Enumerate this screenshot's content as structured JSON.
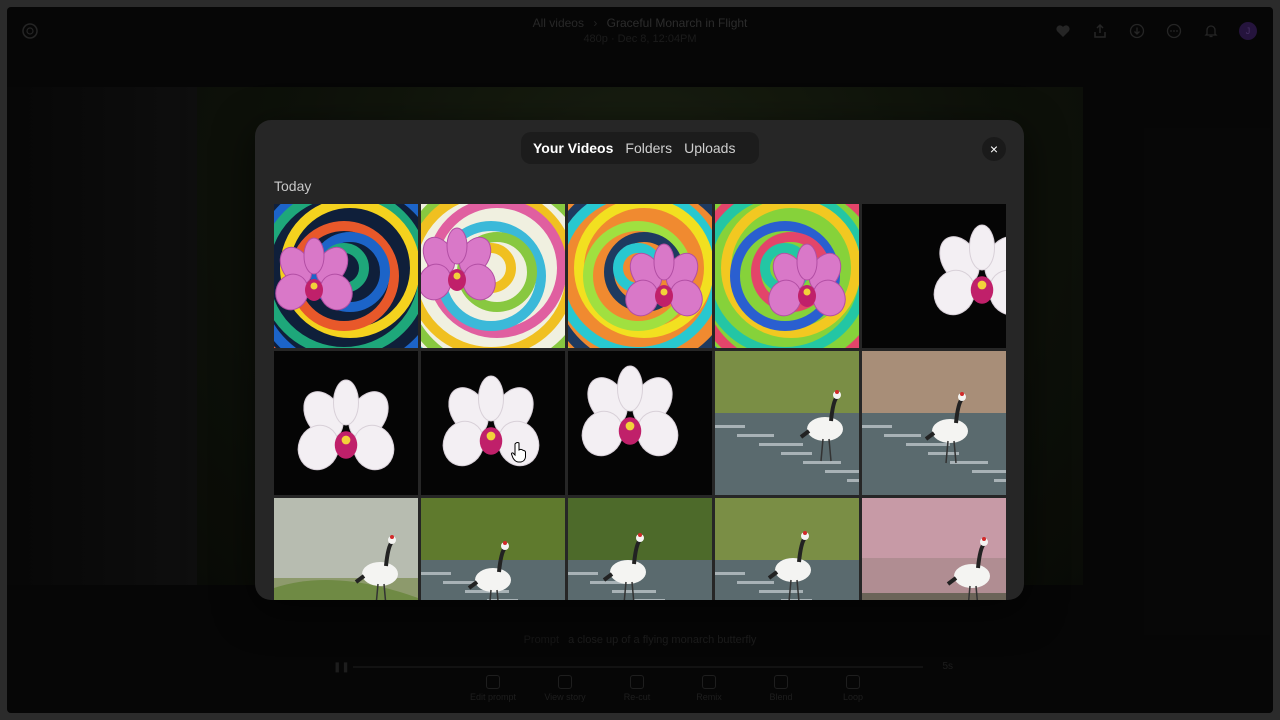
{
  "topbar": {
    "crumb_parent": "All videos",
    "crumb_title": "Graceful Monarch in Flight",
    "meta": "480p · Dec 8, 12:04PM",
    "avatar_initial": "J",
    "icons": [
      "heart-icon",
      "share-icon",
      "download-icon",
      "more-icon",
      "bell-icon"
    ]
  },
  "prompt": {
    "label": "Prompt",
    "text": "a close up of a flying monarch butterfly"
  },
  "player": {
    "duration": "5s"
  },
  "toolbar": {
    "items": [
      {
        "label": "Edit prompt",
        "icon": "pencil-icon"
      },
      {
        "label": "View story",
        "icon": "storyboard-icon"
      },
      {
        "label": "Re-cut",
        "icon": "scissors-icon"
      },
      {
        "label": "Remix",
        "icon": "remix-icon"
      },
      {
        "label": "Blend",
        "icon": "blend-icon"
      },
      {
        "label": "Loop",
        "icon": "loop-icon"
      }
    ]
  },
  "modal": {
    "tabs": [
      {
        "label": "Your Videos",
        "active": true
      },
      {
        "label": "Folders",
        "active": false
      },
      {
        "label": "Uploads",
        "active": false
      }
    ],
    "close_label": "×",
    "section_label": "Today",
    "thumbnails": [
      "orchid-swirl",
      "orchid-swirl",
      "orchid-swirl",
      "orchid-swirl",
      "orchid-white-black",
      "orchid-white-black",
      "orchid-white-black",
      "orchid-white-black",
      "crane-stream",
      "crane-stream",
      "crane-misty",
      "crane-stream",
      "crane-stream",
      "crane-stream",
      "crane-pink-grass"
    ]
  },
  "colors": {
    "modal_bg": "#262626",
    "tab_bg": "#1c1c1c",
    "orchid_pink": "#d86fc4",
    "orchid_white": "#f2eef2"
  }
}
